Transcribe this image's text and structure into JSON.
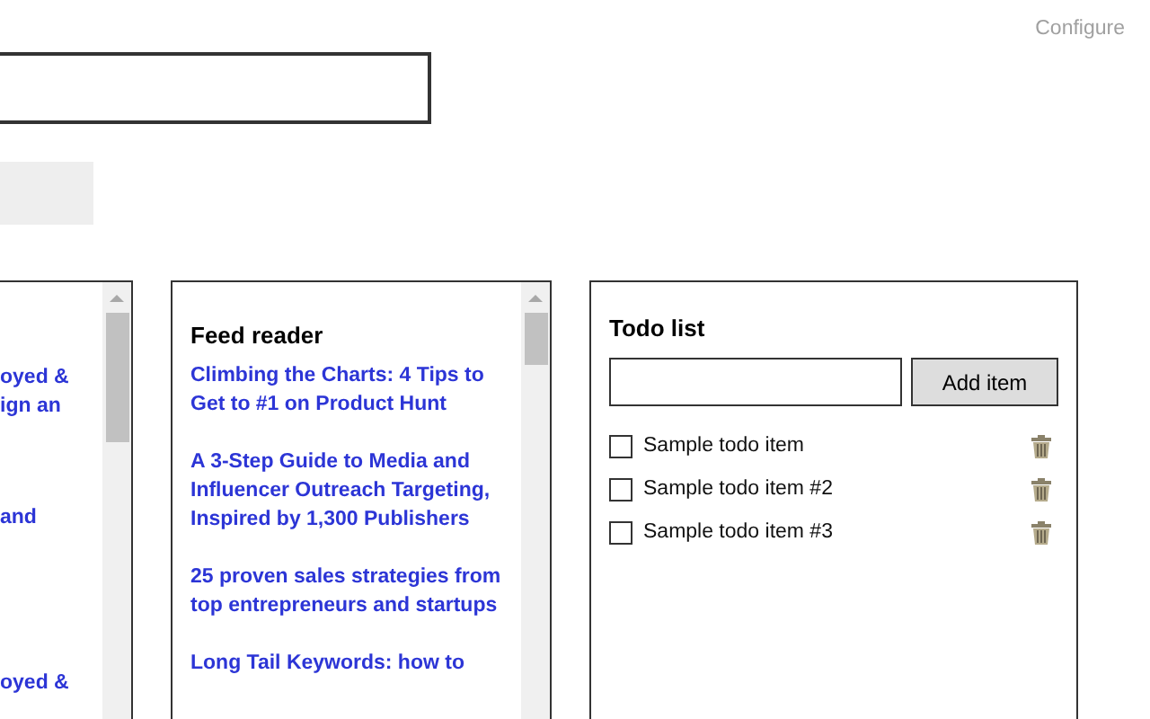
{
  "header": {
    "configure_link": "Configure"
  },
  "left_panel": {
    "items": [
      {
        "text": "oyed &\nign an"
      },
      {
        "text": "and"
      },
      {
        "text": "oyed &"
      }
    ]
  },
  "feed_reader": {
    "title": "Feed reader",
    "items": [
      {
        "text": "Climbing the Charts: 4 Tips to Get to #1 on Product Hunt"
      },
      {
        "text": "A 3-Step Guide to Media and Influencer Outreach Targeting, Inspired by 1,300 Publishers"
      },
      {
        "text": "25 proven sales strategies from top entrepreneurs and startups"
      },
      {
        "text": "Long Tail Keywords: how to"
      }
    ]
  },
  "todo_list": {
    "title": "Todo list",
    "add_button": "Add item",
    "items": [
      {
        "text": "Sample todo item",
        "checked": false
      },
      {
        "text": "Sample todo item #2",
        "checked": false
      },
      {
        "text": "Sample todo item #3",
        "checked": false
      }
    ]
  }
}
